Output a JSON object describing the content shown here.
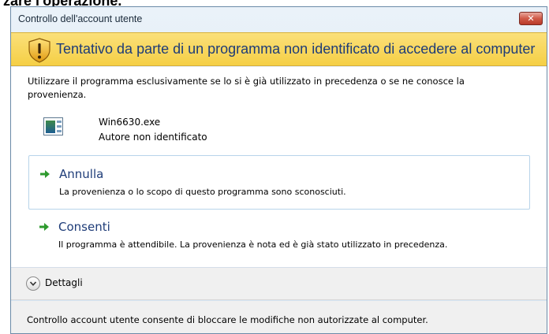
{
  "document": {
    "heading_fragment": "zare l'operazione."
  },
  "window": {
    "title": "Controllo dell'account utente",
    "close_glyph": "✕"
  },
  "banner": {
    "text": "Tentativo da parte di un programma non identificato di accedere al computer",
    "icon": "shield-warning-icon"
  },
  "content": {
    "description": "Utilizzare il programma esclusivamente se lo si è già utilizzato in precedenza o se ne conosce la provenienza.",
    "program": {
      "name": "Win6630.exe",
      "publisher": "Autore non identificato",
      "icon": "program-window-icon"
    }
  },
  "options": [
    {
      "label": "Annulla",
      "description": "La provenienza o lo scopo di questo programma sono sconosciuti.",
      "icon": "green-arrow-icon",
      "selected": true
    },
    {
      "label": "Consenti",
      "description": "Il programma è attendibile. La provenienza è nota ed è già stato utilizzato in precedenza.",
      "icon": "green-arrow-icon",
      "selected": false
    }
  ],
  "details": {
    "label": "Dettagli",
    "icon": "chevron-down-circle-icon"
  },
  "footer": {
    "text": "Controllo account utente consente di bloccare le modifiche non autorizzate al computer."
  },
  "colors": {
    "banner": "#f5cf45",
    "link_blue": "#1e3c78",
    "arrow_green": "#2e9a2e",
    "close_red": "#c8483a"
  }
}
